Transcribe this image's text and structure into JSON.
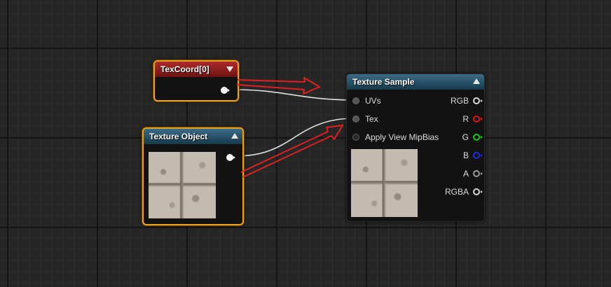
{
  "nodes": {
    "texcoord": {
      "title": "TexCoord[0]"
    },
    "texture_object": {
      "title": "Texture Object"
    },
    "texture_sample": {
      "title": "Texture Sample",
      "inputs": [
        "UVs",
        "Tex",
        "Apply View MipBias"
      ],
      "outputs": [
        {
          "label": "RGB",
          "color": "#d8d8d8"
        },
        {
          "label": "R",
          "color": "#e01414"
        },
        {
          "label": "G",
          "color": "#16c816"
        },
        {
          "label": "B",
          "color": "#1e2ee0"
        },
        {
          "label": "A",
          "color": "#9a9a9a"
        },
        {
          "label": "RGBA",
          "color": "#d8d8d8"
        }
      ]
    }
  },
  "colors": {
    "selection_outline": "#e9a21b",
    "annotation_arrow": "#e02020",
    "wire": "#e0e0e0",
    "grid_background": "#262626"
  }
}
